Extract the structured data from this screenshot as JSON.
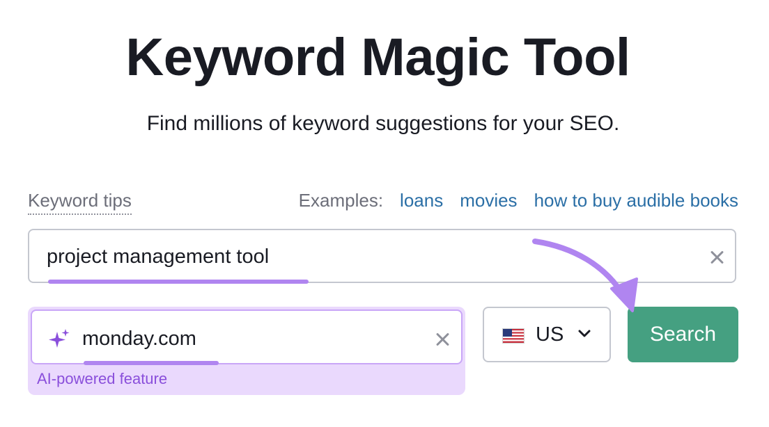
{
  "title": "Keyword Magic Tool",
  "subtitle": "Find millions of keyword suggestions for your SEO.",
  "keyword_tips_label": "Keyword tips",
  "examples": {
    "label": "Examples:",
    "links": [
      "loans",
      "movies",
      "how to buy audible books"
    ]
  },
  "keyword_input": {
    "value": "project management tool"
  },
  "ai_input": {
    "value": "monday.com",
    "label": "AI-powered feature"
  },
  "country": {
    "code": "US"
  },
  "search_button": {
    "label": "Search"
  },
  "colors": {
    "accent_purple": "#b085f0",
    "search_green": "#45a081",
    "link_blue": "#2b6fa6"
  },
  "icons": {
    "clear": "close-icon",
    "sparkle": "sparkle-icon",
    "flag": "us-flag-icon",
    "dropdown": "chevron-down-icon",
    "annotation": "arrow-annotation"
  }
}
